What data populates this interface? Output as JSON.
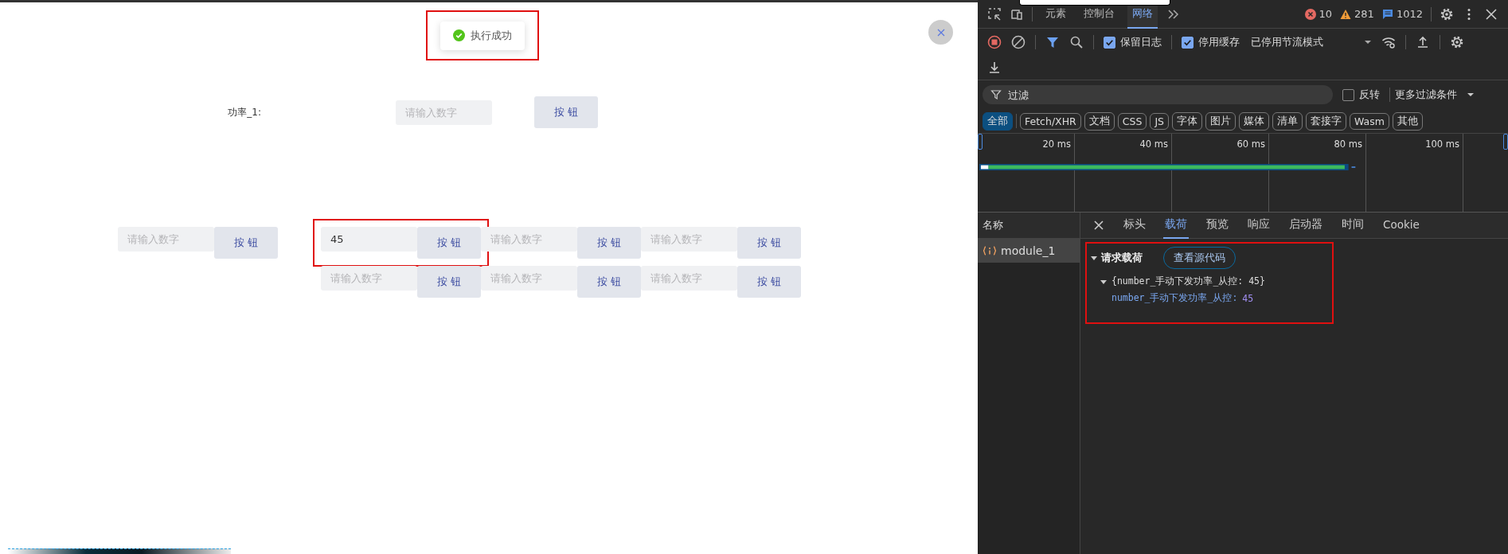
{
  "page": {
    "toast": {
      "text": "执行成功",
      "highlighted": true
    },
    "power": {
      "label": "功率_1:",
      "placeholder": "请输入数字",
      "button": "按 钮"
    },
    "control_rows": [
      [
        {
          "placeholder": "请输入数字",
          "button": "按 钮",
          "highlighted": false
        },
        {
          "value": "45",
          "button": "按 钮",
          "highlighted": true
        },
        {
          "placeholder": "请输入数字",
          "button": "按 钮",
          "highlighted": false
        },
        {
          "placeholder": "请输入数字",
          "button": "按 钮",
          "highlighted": false
        }
      ],
      [
        {
          "placeholder": "请输入数字",
          "button": "按 钮",
          "highlighted": false
        },
        {
          "placeholder": "请输入数字",
          "button": "按 钮",
          "highlighted": false
        },
        {
          "placeholder": "请输入数字",
          "button": "按 钮",
          "highlighted": false
        }
      ]
    ]
  },
  "devtools": {
    "panel_tabs": [
      {
        "label": "元素",
        "selected": false
      },
      {
        "label": "控制台",
        "selected": false
      },
      {
        "label": "网络",
        "selected": true
      }
    ],
    "counts": {
      "errors": "10",
      "warnings": "281",
      "messages": "1012"
    },
    "toolbar": {
      "preserve_log": {
        "label": "保留日志",
        "checked": true
      },
      "disable_cache": {
        "label": "停用缓存",
        "checked": true
      },
      "throttling": "已停用节流模式"
    },
    "filter": {
      "placeholder": "过滤",
      "invert": {
        "label": "反转",
        "checked": false
      },
      "more": "更多过滤条件"
    },
    "type_filters": [
      {
        "label": "全部",
        "selected": true
      },
      {
        "label": "Fetch/XHR",
        "selected": false
      },
      {
        "label": "文档",
        "selected": false
      },
      {
        "label": "CSS",
        "selected": false
      },
      {
        "label": "JS",
        "selected": false
      },
      {
        "label": "字体",
        "selected": false
      },
      {
        "label": "图片",
        "selected": false
      },
      {
        "label": "媒体",
        "selected": false
      },
      {
        "label": "清单",
        "selected": false
      },
      {
        "label": "套接字",
        "selected": false
      },
      {
        "label": "Wasm",
        "selected": false
      },
      {
        "label": "其他",
        "selected": false
      }
    ],
    "timeline": {
      "ticks": [
        "20 ms",
        "40 ms",
        "60 ms",
        "80 ms",
        "100 ms"
      ]
    },
    "requests": {
      "header": "名称",
      "items": [
        {
          "name": "module_1",
          "selected": true
        }
      ]
    },
    "detail_tabs": [
      {
        "label": "标头",
        "selected": false
      },
      {
        "label": "载荷",
        "selected": true
      },
      {
        "label": "预览",
        "selected": false
      },
      {
        "label": "响应",
        "selected": false
      },
      {
        "label": "启动器",
        "selected": false
      },
      {
        "label": "时间",
        "selected": false
      },
      {
        "label": "Cookie",
        "selected": false
      }
    ],
    "payload": {
      "title": "请求载荷",
      "view_source": "查看源代码",
      "summary": "{number_手动下发功率_从控: 45}",
      "key": "number_手动下发功率_从控:",
      "value": "45",
      "highlighted": true
    }
  }
}
